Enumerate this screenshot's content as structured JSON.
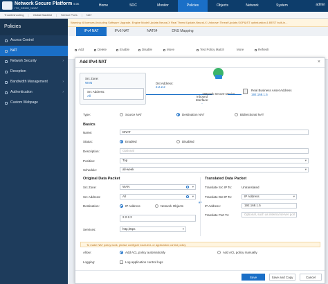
{
  "app": {
    "title": "Network Secure Platform",
    "version": "5.0K",
    "device": "ITG_DEMO_NGAF",
    "nav": [
      "Home",
      "SOC",
      "Monitor",
      "Policies",
      "Objects",
      "Network",
      "System"
    ],
    "active_nav": "Policies",
    "user": "admin"
  },
  "breadcrumb": [
    "Troubleshooting",
    "Global Blacklist",
    "Service Ports",
    "NAT"
  ],
  "sidebar": {
    "title": "Policies",
    "items": [
      {
        "label": "Access Control",
        "chev": ""
      },
      {
        "label": "NAT",
        "chev": ""
      },
      {
        "label": "Network Security",
        "chev": "›"
      },
      {
        "label": "Deception",
        "chev": ""
      },
      {
        "label": "Bandwidth Management",
        "chev": "›"
      },
      {
        "label": "Authentication",
        "chev": "›"
      },
      {
        "label": "Custom Webpage",
        "chev": ""
      }
    ]
  },
  "warning": "Warning: 6 licenses (including Software Upgrade, Engine Model Update,Neural-X Real Threat Update,Neural-X Unknown Threat Update,SOP&IST optimization & BEST built-in...",
  "tabs": [
    "IPv4 NAT",
    "IPv6 NAT",
    "NAT64",
    "DNS Mapping"
  ],
  "toolbar": {
    "add": "Add",
    "delete": "Delete",
    "enable": "Enable",
    "disable": "Disable",
    "move": "Move",
    "test": "Test Policy Match",
    "more": "More",
    "refresh": "Refresh"
  },
  "modal": {
    "title": "Add IPv4 NAT",
    "close": "×",
    "diagram": {
      "src_zone_label": "Src Zone:",
      "src_zone_value": "WAN",
      "src_addr_label": "Src Address:",
      "src_addr_value": "All",
      "dst_label": "Dst Address:",
      "dst_value": "2.2.2.2",
      "inbound_label": "Inbound Interface:",
      "inbound_value": "-",
      "device_label": "Network Secure Device",
      "server_label": "Real Business Asset Address",
      "server_value": "192.168.1.5"
    },
    "type": {
      "label": "Type:",
      "options": [
        "Source NAT",
        "Destination NAT",
        "Bidirectional NAT"
      ],
      "selected": "Destination NAT"
    },
    "basics": {
      "title": "Basics",
      "name_label": "Name:",
      "name_value": "DNAT",
      "status_label": "Status:",
      "status_on": "Enabled",
      "status_off": "Disabled",
      "description_label": "Description:",
      "description_placeholder": "Optional",
      "position_label": "Position:",
      "position_value": "Top",
      "schedule_label": "Schedule:",
      "schedule_value": "all-week"
    },
    "original": {
      "title": "Original Data Packet",
      "src_zone_label": "Src Zone:",
      "src_zone_value": "WAN",
      "src_addr_label": "Src Address:",
      "src_addr_value": "All",
      "dest_label": "Destination:",
      "dest_opt1": "IP Address",
      "dest_opt2": "Network Objects",
      "dest_ip_value": "2.2.2.2",
      "services_label": "Services:",
      "services_value": "http,https"
    },
    "translated": {
      "title": "Translated Data Packet",
      "src_ip_label": "Translate Src IP To:",
      "src_ip_value": "Untranslated",
      "dst_ip_label": "Translate Dst IP To:",
      "dst_ip_value": "IP Address",
      "ip_label": "IP Address:",
      "ip_value": "192.168.1.5",
      "port_label": "Translate Port To:",
      "port_placeholder": "Optional, such as internal server port"
    },
    "hint": "To make NAT policy work, please configure local ACL or application control policy",
    "allow_label": "Allow:",
    "allow_auto": "Add ACL policy automatically",
    "allow_manual": "Add ACL policy manually",
    "logging_label": "Logging:",
    "logging_value": "Log application control logs",
    "save": "Save",
    "save_copy": "Save and Copy",
    "cancel": "Cancel"
  }
}
